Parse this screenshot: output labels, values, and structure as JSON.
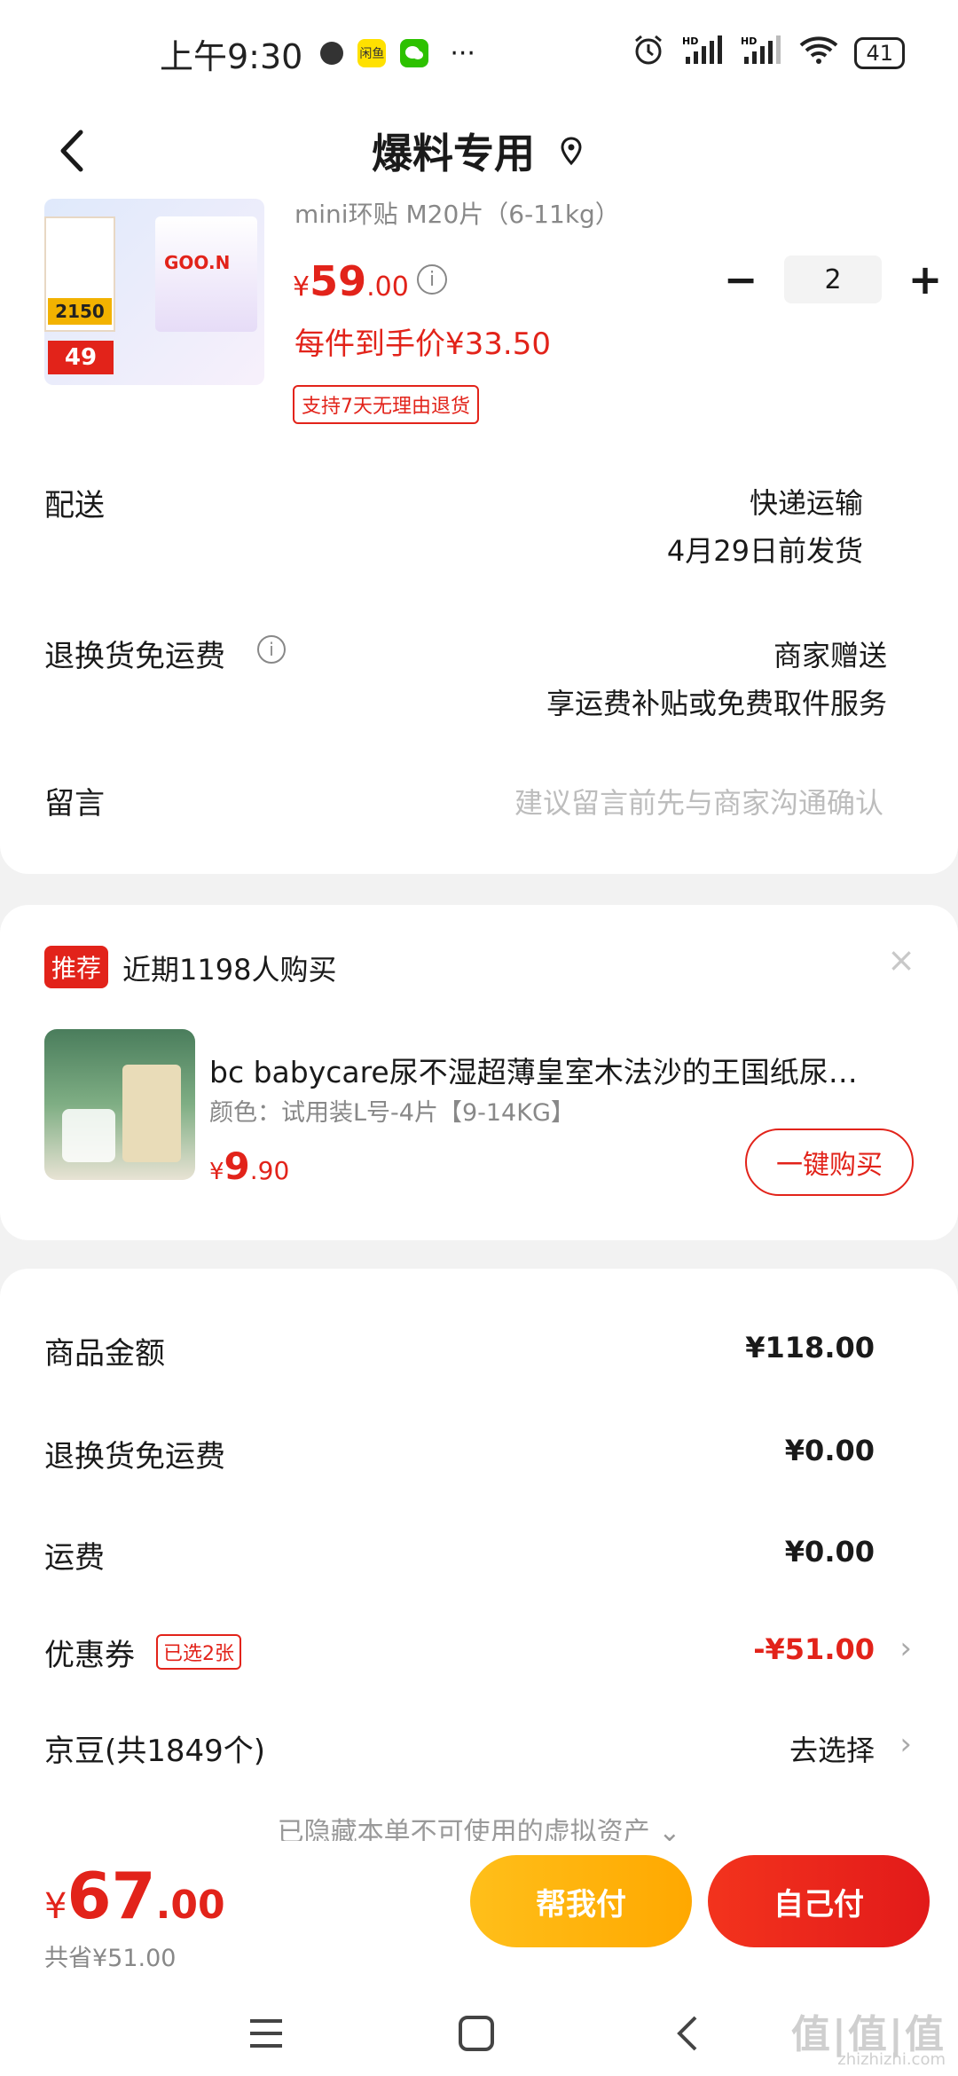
{
  "status_bar": {
    "time": "上午9:30",
    "app_badge": "闲鱼",
    "more": "···",
    "battery": "41"
  },
  "header": {
    "title": "爆料专用"
  },
  "product": {
    "name": "mini环贴 M20片（6-11kg）",
    "price_symbol": "¥",
    "price_int": "59",
    "price_dec": ".00",
    "per_item_price": "每件到手价¥33.50",
    "return_policy": "支持7天无理由退货",
    "quantity": "2",
    "img_badge_top": "2150",
    "img_badge_bottom": "49",
    "img_brand": "GOO.N"
  },
  "delivery": {
    "label": "配送",
    "method": "快递运输",
    "ship_by": "4月29日前发货"
  },
  "return_shipping": {
    "label": "退换货免运费",
    "value_line1": "商家赠送",
    "value_line2": "享运费补贴或免费取件服务"
  },
  "message": {
    "label": "留言",
    "placeholder": "建议留言前先与商家沟通确认"
  },
  "recommend": {
    "tag": "推荐",
    "text": "近期1198人购买",
    "close": "×",
    "product_name": "bc babycare尿不湿超薄皇室木法沙的王国纸尿…",
    "spec": "颜色：试用装L号-4片【9-14KG】",
    "price_symbol": "¥",
    "price_int": "9",
    "price_dec": ".90",
    "buy_label": "一键购买"
  },
  "summary": {
    "goods_label": "商品金额",
    "goods_value": "¥118.00",
    "return_label": "退换货免运费",
    "return_value": "¥0.00",
    "freight_label": "运费",
    "freight_value": "¥0.00",
    "coupon_label": "优惠券",
    "coupon_tag": "已选2张",
    "coupon_value": "-¥51.00",
    "beans_label": "京豆(共1849个)",
    "beans_value": "去选择",
    "hidden_note": "已隐藏本单不可使用的虚拟资产 ⌄"
  },
  "bottom": {
    "total_symbol": "¥",
    "total_int": "67",
    "total_dec": ".00",
    "saved": "共省¥51.00",
    "help_pay": "帮我付",
    "self_pay": "自己付"
  },
  "watermark": {
    "main": "值|值|值",
    "sub": "zhizhizhi.com"
  },
  "colors": {
    "accent": "#e2231a",
    "help_button": "#ffb400"
  }
}
